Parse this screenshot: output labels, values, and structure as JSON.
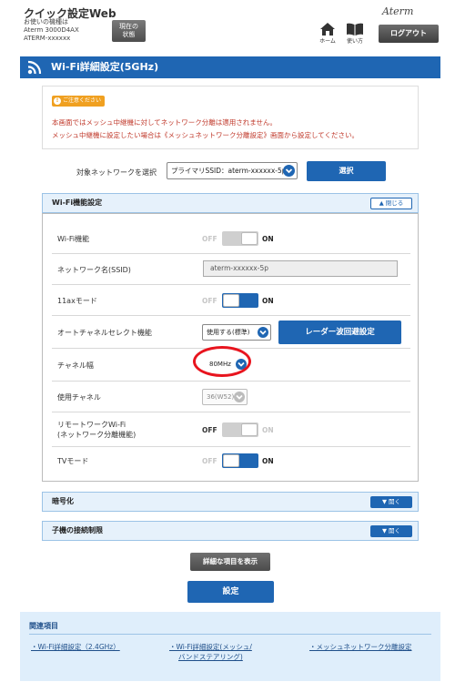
{
  "header": {
    "app_title": "クイック設定Web",
    "device_lines": [
      "お使いの機種は",
      "Aterm 3000D4AX",
      "ATERM-xxxxxx"
    ],
    "status_button": [
      "現在の",
      "状態"
    ],
    "logo": "Aterm",
    "home_label": "ホーム",
    "howto_label": "使い方",
    "logout_label": "ログアウト"
  },
  "page_title": "Wi-Fi詳細設定(5GHz)",
  "notice": {
    "tag": "ご注意ください",
    "lines": [
      "本画面ではメッシュ中継機に対してネットワーク分離は適用されません。",
      "メッシュ中継機に設定したい場合は《メッシュネットワーク分離設定》画面から設定してください。"
    ]
  },
  "target": {
    "label": "対象ネットワークを選択",
    "selected": "プライマリSSID：aterm-xxxxxx-5p",
    "select_button": "選択"
  },
  "wifi_section": {
    "title": "Wi-Fi機能設定",
    "toggle_label": "閉じる",
    "rows": [
      {
        "label": "Wi-Fi機能",
        "off": "OFF",
        "on": "ON",
        "state": "disabled-off"
      },
      {
        "label": "ネットワーク名(SSID)",
        "value": "aterm-xxxxxx-5p"
      },
      {
        "label": "11axモード",
        "off": "OFF",
        "on": "ON",
        "state": "on"
      },
      {
        "label": "オートチャネルセレクト機能",
        "value": "使用する(標準)",
        "button": "レーダー波回避設定"
      },
      {
        "label": "チャネル幅",
        "value": "80MHz"
      },
      {
        "label": "使用チャネル",
        "value": "36(W52)"
      },
      {
        "label": [
          "リモートワークWi-Fi",
          "(ネットワーク分離機能)"
        ],
        "off": "OFF",
        "on": "ON",
        "state": "off"
      },
      {
        "label": "TVモード",
        "off": "OFF",
        "on": "ON",
        "state": "on"
      }
    ]
  },
  "encryption_section": {
    "title": "暗号化",
    "toggle_label": "開く"
  },
  "child_section": {
    "title": "子機の接続制限",
    "toggle_label": "開く"
  },
  "detail_button": "詳細な項目を表示",
  "set_button": "設定",
  "related": {
    "title": "関連項目",
    "links": [
      [
        "Wi-Fi詳細設定（2.4GHz）"
      ],
      [
        "Wi-Fi詳細設定(メッシュ/",
        "バンドステアリング)"
      ],
      [
        "メッシュネットワーク分離設定"
      ]
    ]
  },
  "colors": {
    "accent": "#1f66b3",
    "notice_text": "#c0392b",
    "highlight_circle": "#e8141e"
  }
}
